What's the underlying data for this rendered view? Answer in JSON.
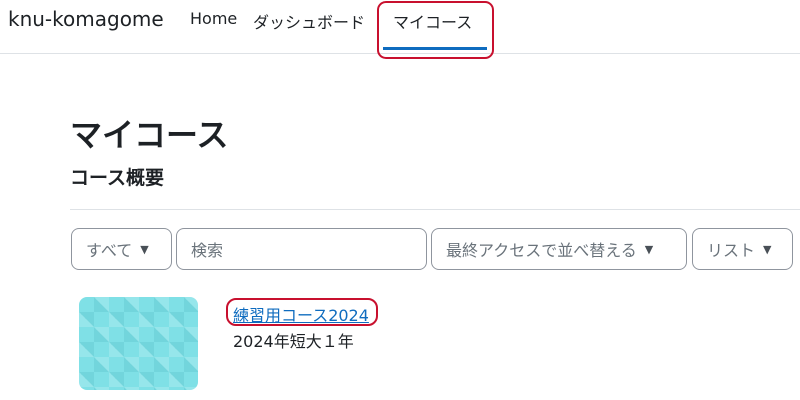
{
  "site": {
    "name": "knu-komagome"
  },
  "nav": {
    "items": [
      {
        "label": "Home"
      },
      {
        "label": "ダッシュボード"
      },
      {
        "label": "マイコース",
        "active": true
      }
    ]
  },
  "page": {
    "title": "マイコース",
    "section_title": "コース概要"
  },
  "filters": {
    "grouping": {
      "selected": "すべて"
    },
    "search": {
      "placeholder": "検索",
      "value": ""
    },
    "sort": {
      "selected": "最終アクセスで並べ替える"
    },
    "view": {
      "selected": "リスト"
    }
  },
  "courses": [
    {
      "name": "練習用コース2024",
      "category": "2024年短大１年"
    }
  ],
  "colors": {
    "accent": "#0f6cbf",
    "highlight": "#c8102e",
    "thumbnail": "#7fe0e6"
  },
  "icons": {
    "dropdown": "chevron-down-icon"
  }
}
